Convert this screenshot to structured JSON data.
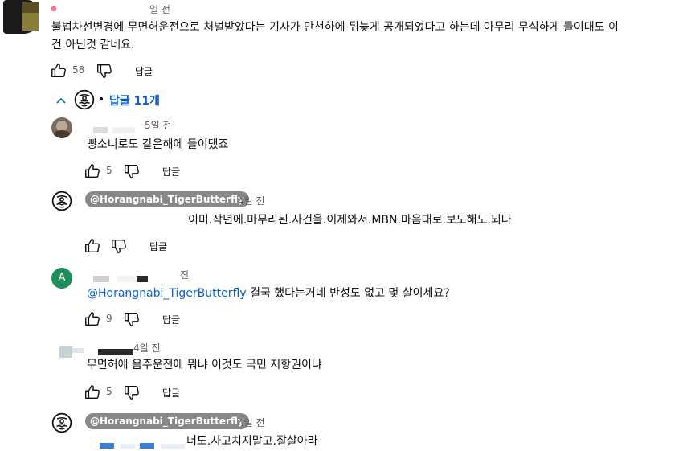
{
  "top_comment": {
    "time": "일 전",
    "text_line1": "불법차선변경에 무면허운전으로 처벌받았다는 기사가 만천하에 뒤늦게 공개되었다고 하는데 아무리 무식하게 들이대도 이",
    "text_line2": "건 아닌것 같네요.",
    "likes": "58",
    "reply_label": "답글"
  },
  "replies_toggle": {
    "bullet": "•",
    "label": "답글 11개"
  },
  "replies": [
    {
      "time": "5일 전",
      "text": "빵소니로도 같은해에 들이댔죠",
      "likes": "5",
      "reply_label": "답글"
    },
    {
      "channel": "@Horangnabi_TigerButterfly",
      "time": "4일 전",
      "text": "이미.작년에.마무리된.사건을.이제와서.MBN.마음대로.보도해도.되나",
      "likes": "",
      "reply_label": "답글"
    },
    {
      "avatar_letter": "A",
      "time": "전",
      "mention": "@Horangnabi_TigerButterfly",
      "text": " 결국 했다는거네 반성도 없고 몇 살이세요?",
      "likes": "9",
      "reply_label": "답글"
    },
    {
      "time": "4일 전",
      "text": "무면허에 음주운전에 뭐냐 이것도 국민 저항권이냐",
      "likes": "5",
      "reply_label": "답글"
    },
    {
      "channel": "@Horangnabi_TigerButterfly",
      "time": "4일 전",
      "text": "너도.사고치지말고.잘살아라"
    }
  ],
  "colors": {
    "link": "#065fd4",
    "chip": "#888888",
    "avatar_green": "#1e8e5a"
  },
  "icons": [
    "thumb-up-icon",
    "thumb-down-icon",
    "chevron-up-icon",
    "mask-avatar-icon"
  ]
}
